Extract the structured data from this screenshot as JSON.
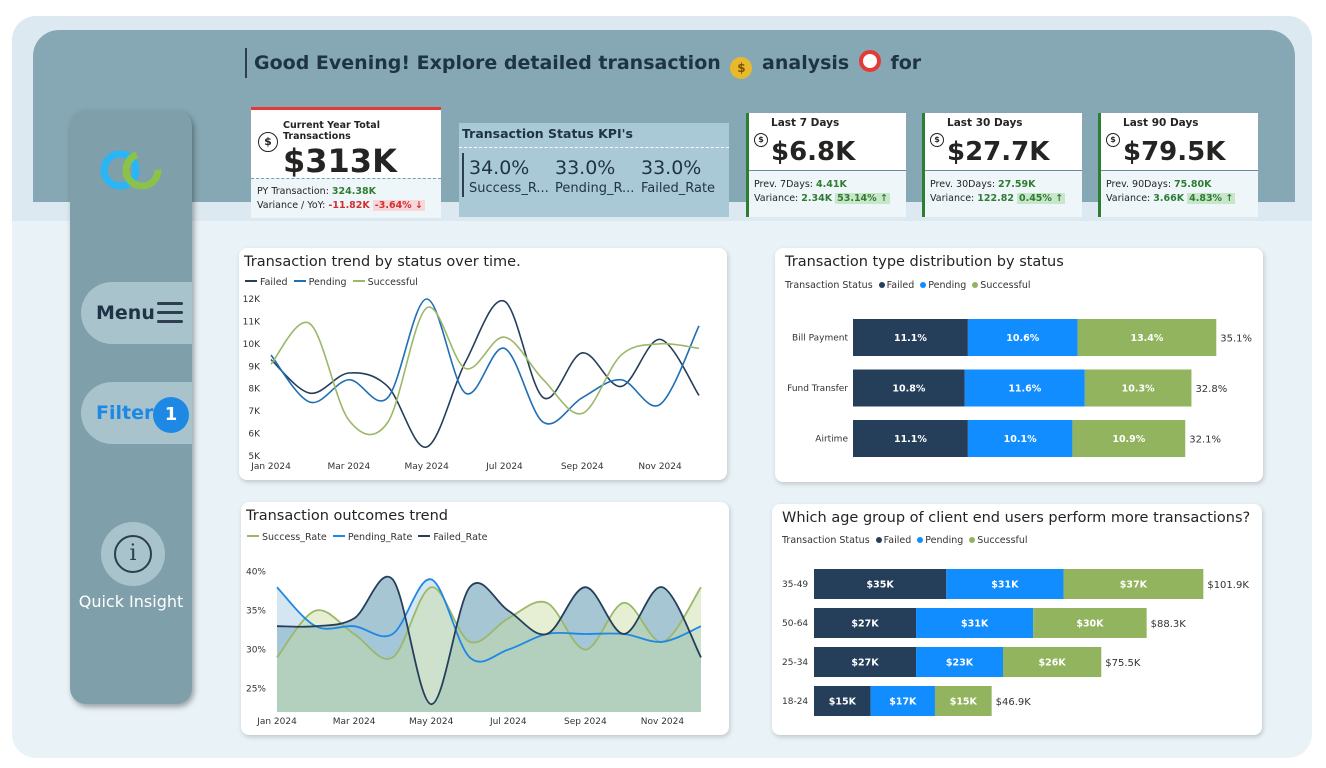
{
  "header": {
    "greeting_part1": "Good Evening! Explore detailed transaction",
    "greeting_part2": "analysis",
    "greeting_part3": "for"
  },
  "sidebar": {
    "menu_label": "Menu",
    "filter_label": "Filter",
    "filter_count": "1",
    "insight_label": "Quick Insight"
  },
  "kpi_main": {
    "title": "Current Year Total Transactions",
    "value": "$313K",
    "py_label": "PY Transaction: ",
    "py_value": "324.38K",
    "variance_label": "Variance / YoY: ",
    "variance_value": "-11.82K",
    "variance_pct": "-3.64% ↓"
  },
  "status_kpi": {
    "title": "Transaction Status KPI's",
    "items": [
      {
        "value": "34.0%",
        "label": "Success_R..."
      },
      {
        "value": "33.0%",
        "label": "Pending_R..."
      },
      {
        "value": "33.0%",
        "label": "Failed_Rate"
      }
    ]
  },
  "periods": [
    {
      "title": "Last 7 Days",
      "value": "$6.8K",
      "prev_label": "Prev. 7Days: ",
      "prev_value": "4.41K",
      "var_label": "Variance: ",
      "var_value": "2.34K",
      "var_pct": "53.14% ↑"
    },
    {
      "title": "Last 30 Days",
      "value": "$27.7K",
      "prev_label": "Prev. 30Days: ",
      "prev_value": "27.59K",
      "var_label": "Variance: ",
      "var_value": "122.82",
      "var_pct": "0.45% ↑"
    },
    {
      "title": "Last 90 Days",
      "value": "$79.5K",
      "prev_label": "Prev. 90Days: ",
      "prev_value": "75.80K",
      "var_label": "Variance: ",
      "var_value": "3.66K",
      "var_pct": "4.83% ↑"
    }
  ],
  "colors": {
    "failed": "#253f5b",
    "pending": "#118dff",
    "successful": "#93b45e",
    "trend_failed": "#253f5b",
    "trend_pending": "#1f6fb5",
    "trend_successful": "#9bb86a",
    "area_bg": "#a7c6d3"
  },
  "chart_data": [
    {
      "type": "line",
      "title": "Transaction trend by status over time.",
      "legend_position": "top-left",
      "x_tick_labels": [
        "Jan 2024",
        "Mar 2024",
        "May 2024",
        "Jul 2024",
        "Sep 2024",
        "Nov 2024"
      ],
      "y_tick_labels": [
        "5K",
        "6K",
        "7K",
        "8K",
        "9K",
        "10K",
        "11K",
        "12K"
      ],
      "ylim": [
        5000,
        12000
      ],
      "x": [
        "Jan 2024",
        "Feb 2024",
        "Mar 2024",
        "Apr 2024",
        "May 2024",
        "Jun 2024",
        "Jul 2024",
        "Aug 2024",
        "Sep 2024",
        "Oct 2024",
        "Nov 2024",
        "Dec 2024"
      ],
      "series": [
        {
          "name": "Failed",
          "values": [
            9300,
            7800,
            8700,
            8100,
            5400,
            9200,
            11900,
            7600,
            9600,
            8100,
            10200,
            7700
          ]
        },
        {
          "name": "Pending",
          "values": [
            9500,
            7400,
            8400,
            7600,
            12000,
            7800,
            9800,
            6500,
            7600,
            8400,
            7300,
            10800
          ]
        },
        {
          "name": "Successful",
          "values": [
            9100,
            10900,
            6600,
            6500,
            11600,
            8900,
            10300,
            8400,
            6900,
            9500,
            10000,
            9800
          ]
        }
      ]
    },
    {
      "type": "area",
      "title": "Transaction outcomes trend",
      "legend_position": "top-left",
      "x_tick_labels": [
        "Jan 2024",
        "Mar 2024",
        "May 2024",
        "Jul 2024",
        "Sep 2024",
        "Nov 2024"
      ],
      "y_tick_labels": [
        "25%",
        "30%",
        "35%",
        "40%"
      ],
      "ylim": [
        22,
        42
      ],
      "x": [
        "Jan 2024",
        "Feb 2024",
        "Mar 2024",
        "Apr 2024",
        "May 2024",
        "Jun 2024",
        "Jul 2024",
        "Aug 2024",
        "Sep 2024",
        "Oct 2024",
        "Nov 2024",
        "Dec 2024"
      ],
      "series": [
        {
          "name": "Success_Rate",
          "values": [
            29,
            35,
            32,
            29,
            38,
            31,
            34,
            36,
            30,
            36,
            31,
            38
          ]
        },
        {
          "name": "Pending_Rate",
          "values": [
            38,
            33,
            33,
            32,
            39,
            29,
            30,
            32,
            32,
            32,
            31,
            33
          ]
        },
        {
          "name": "Failed_Rate",
          "values": [
            33,
            33,
            34,
            39,
            23,
            38,
            35,
            32,
            38,
            32,
            38,
            29
          ]
        }
      ]
    },
    {
      "type": "bar",
      "orientation": "horizontal",
      "stacked": true,
      "title": "Transaction type distribution by status",
      "legend_title": "Transaction Status",
      "legend_position": "top-left",
      "categories": [
        "Bill Payment",
        "Fund Transfer",
        "Airtime"
      ],
      "totals": [
        "35.1%",
        "32.8%",
        "32.1%"
      ],
      "series": [
        {
          "name": "Failed",
          "values": [
            11.1,
            10.8,
            11.1
          ],
          "labels": [
            "11.1%",
            "10.8%",
            "11.1%"
          ]
        },
        {
          "name": "Pending",
          "values": [
            10.6,
            11.6,
            10.1
          ],
          "labels": [
            "10.6%",
            "11.6%",
            "10.1%"
          ]
        },
        {
          "name": "Successful",
          "values": [
            13.4,
            10.3,
            10.9
          ],
          "labels": [
            "13.4%",
            "10.3%",
            "10.9%"
          ]
        }
      ]
    },
    {
      "type": "bar",
      "orientation": "horizontal",
      "stacked": true,
      "title": "Which age group of client end users perform more transactions?",
      "legend_title": "Transaction Status",
      "legend_position": "top-left",
      "categories": [
        "35-49",
        "50-64",
        "25-34",
        "18-24"
      ],
      "totals": [
        "$101.9K",
        "$88.3K",
        "$75.5K",
        "$46.9K"
      ],
      "series": [
        {
          "name": "Failed",
          "values": [
            35,
            27,
            27,
            15
          ],
          "labels": [
            "$35K",
            "$27K",
            "$27K",
            "$15K"
          ]
        },
        {
          "name": "Pending",
          "values": [
            31,
            31,
            23,
            17
          ],
          "labels": [
            "$31K",
            "$31K",
            "$23K",
            "$17K"
          ]
        },
        {
          "name": "Successful",
          "values": [
            37,
            30,
            26,
            15
          ],
          "labels": [
            "$37K",
            "$30K",
            "$26K",
            "$15K"
          ]
        }
      ]
    }
  ]
}
